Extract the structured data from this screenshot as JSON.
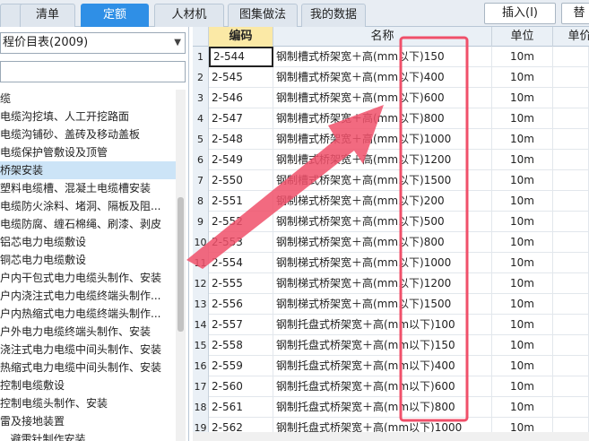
{
  "tabs": [
    {
      "label": "清单",
      "active": false
    },
    {
      "label": "定额",
      "active": true
    },
    {
      "label": "人材机",
      "active": false
    },
    {
      "label": "图集做法",
      "active": false
    },
    {
      "label": "我的数据",
      "active": false
    }
  ],
  "toolbar": {
    "insert_label": "插入(I)",
    "partial_label": "替"
  },
  "left": {
    "library_value": "程价目表(2009)",
    "tree": [
      "缆",
      "电缆沟挖填、人工开挖路面",
      "电缆沟铺砂、盖砖及移动盖板",
      "电缆保护管敷设及顶管",
      "桥架安装",
      "塑料电缆槽、混凝土电缆槽安装",
      "电缆防火涂料、堵洞、隔板及阻...",
      "电缆防腐、缠石棉绳、刷漆、剥皮",
      "铝芯电力电缆敷设",
      "铜芯电力电缆敷设",
      "户内干包式电力电缆头制作、安装",
      "户内浇注式电力电缆终端头制作...",
      "户内热缩式电力电缆终端头制作...",
      "户外电力电缆终端头制作、安装",
      "浇注式电力电缆中间头制作、安装",
      "热缩式电力电缆中间头制作、安装",
      "控制电缆敷设",
      "控制电缆头制作、安装",
      "雷及接地装置",
      "...避雷针制作安装"
    ]
  },
  "grid": {
    "headers": {
      "code": "编码",
      "name": "名称",
      "unit": "单位",
      "extra": "单价"
    },
    "rows": [
      {
        "idx": "1",
        "code": "2-544",
        "name": "钢制槽式桥架宽＋高(mm以下)150",
        "unit": "10m"
      },
      {
        "idx": "2",
        "code": "2-545",
        "name": "钢制槽式桥架宽＋高(mm以下)400",
        "unit": "10m"
      },
      {
        "idx": "3",
        "code": "2-546",
        "name": "钢制槽式桥架宽＋高(mm以下)600",
        "unit": "10m"
      },
      {
        "idx": "4",
        "code": "2-547",
        "name": "钢制槽式桥架宽＋高(mm以下)800",
        "unit": "10m"
      },
      {
        "idx": "5",
        "code": "2-548",
        "name": "钢制槽式桥架宽＋高(mm以下)1000",
        "unit": "10m"
      },
      {
        "idx": "6",
        "code": "2-549",
        "name": "钢制槽式桥架宽＋高(mm以下)1200",
        "unit": "10m"
      },
      {
        "idx": "7",
        "code": "2-550",
        "name": "钢制槽式桥架宽＋高(mm以下)1500",
        "unit": "10m"
      },
      {
        "idx": "8",
        "code": "2-551",
        "name": "钢制梯式桥架宽＋高(mm以下)200",
        "unit": "10m"
      },
      {
        "idx": "9",
        "code": "2-552",
        "name": "钢制梯式桥架宽＋高(mm以下)500",
        "unit": "10m"
      },
      {
        "idx": "10",
        "code": "2-553",
        "name": "钢制梯式桥架宽＋高(mm以下)800",
        "unit": "10m"
      },
      {
        "idx": "11",
        "code": "2-554",
        "name": "钢制梯式桥架宽＋高(mm以下)1000",
        "unit": "10m"
      },
      {
        "idx": "12",
        "code": "2-555",
        "name": "钢制梯式桥架宽＋高(mm以下)1200",
        "unit": "10m"
      },
      {
        "idx": "13",
        "code": "2-556",
        "name": "钢制梯式桥架宽＋高(mm以下)1500",
        "unit": "10m"
      },
      {
        "idx": "14",
        "code": "2-557",
        "name": "钢制托盘式桥架宽＋高(mm以下)100",
        "unit": "10m"
      },
      {
        "idx": "15",
        "code": "2-558",
        "name": "钢制托盘式桥架宽＋高(mm以下)150",
        "unit": "10m"
      },
      {
        "idx": "16",
        "code": "2-559",
        "name": "钢制托盘式桥架宽＋高(mm以下)400",
        "unit": "10m"
      },
      {
        "idx": "17",
        "code": "2-560",
        "name": "钢制托盘式桥架宽＋高(mm以下)600",
        "unit": "10m"
      },
      {
        "idx": "18",
        "code": "2-561",
        "name": "钢制托盘式桥架宽＋高(mm以下)800",
        "unit": "10m"
      },
      {
        "idx": "19",
        "code": "2-562",
        "name": "钢制托盘式桥架宽＋高(mm以下)1000",
        "unit": "10m"
      }
    ]
  },
  "colors": {
    "accent": "#2f8fe6",
    "annotation": "#f0506a"
  }
}
